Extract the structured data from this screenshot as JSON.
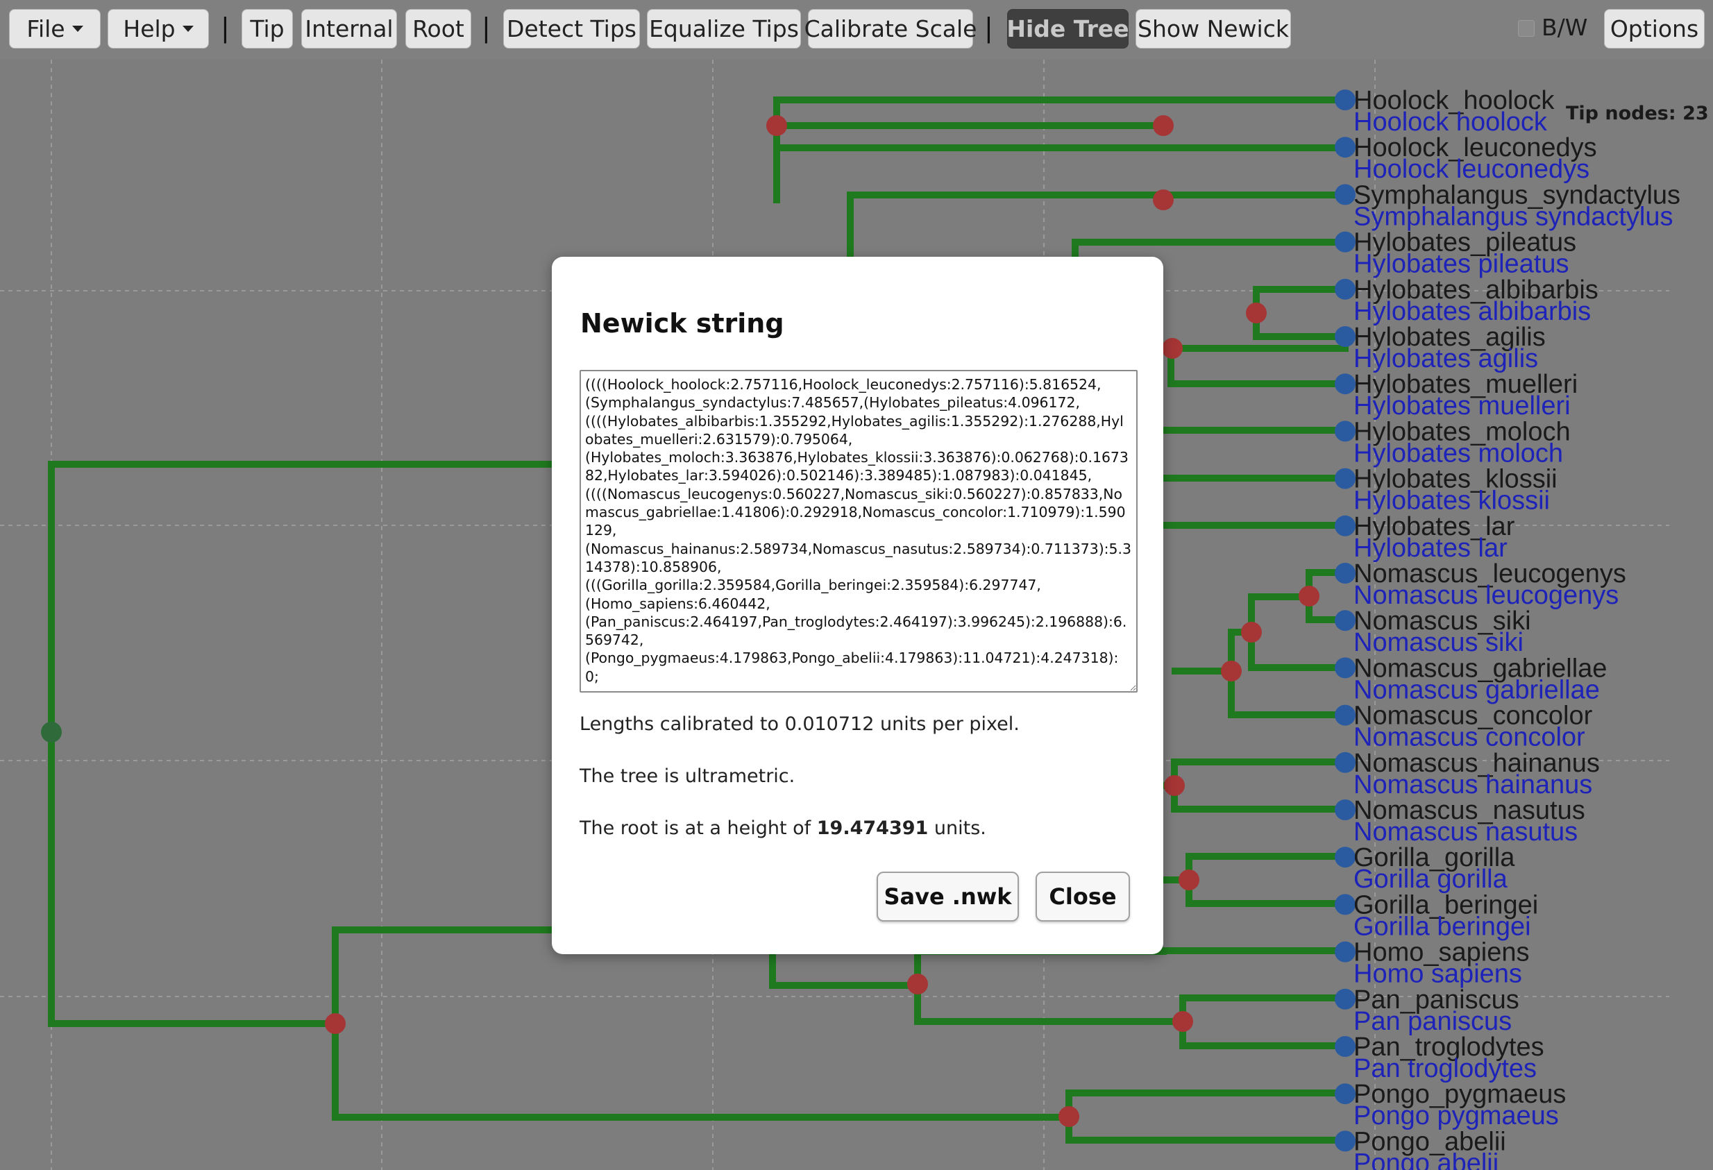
{
  "toolbar": {
    "file": "File",
    "help": "Help",
    "sep": "|",
    "tip": "Tip",
    "internal": "Internal",
    "root": "Root",
    "detect_tips": "Detect Tips",
    "equalize_tips": "Equalize Tips",
    "calibrate_scale": "Calibrate Scale",
    "hide_tree": "Hide Tree",
    "show_newick": "Show Newick",
    "bw_label": "B/W",
    "options": "Options"
  },
  "tip_count": "Tip nodes: 23",
  "tips": [
    "Hoolock_hoolock",
    "Hoolock_leuconedys",
    "Symphalangus_syndactylus",
    "Hylobates_pileatus",
    "Hylobates_albibarbis",
    "Hylobates_agilis",
    "Hylobates_muelleri",
    "Hylobates_moloch",
    "Hylobates_klossii",
    "Hylobates_lar",
    "Nomascus_leucogenys",
    "Nomascus_siki",
    "Nomascus_gabriellae",
    "Nomascus_concolor",
    "Nomascus_hainanus",
    "Nomascus_nasutus",
    "Gorilla_gorilla",
    "Gorilla_beringei",
    "Homo_sapiens",
    "Pan_paniscus",
    "Pan_troglodytes",
    "Pongo_pygmaeus",
    "Pongo_abelii"
  ],
  "tip_labels": [
    "Hoolock hoolock",
    "Hoolock leuconedys",
    "Symphalangus syndactylus",
    "Hylobates pileatus",
    "Hylobates albibarbis",
    "Hylobates agilis",
    "Hylobates muelleri",
    "Hylobates moloch",
    "Hylobates klossii",
    "Hylobates lar",
    "Nomascus leucogenys",
    "Nomascus siki",
    "Nomascus gabriellae",
    "Nomascus concolor",
    "Nomascus hainanus",
    "Nomascus nasutus",
    "Gorilla gorilla",
    "Gorilla beringei",
    "Homo sapiens",
    "Pan paniscus",
    "Pan troglodytes",
    "Pongo pygmaeus",
    "Pongo abelii"
  ],
  "colors": {
    "branch": "#1f7a1f",
    "internal_node": "#a63535",
    "root_node": "#2f6b3a",
    "tip_node": "#2a5aa0",
    "label_blue": "#1d22b8",
    "label_dark": "#1a1a1a",
    "background": "#7d7d7d",
    "grid": "#9a9a9a"
  },
  "modal": {
    "title": "Newick string",
    "newick": "((((Hoolock_hoolock:2.757116,Hoolock_leuconedys:2.757116):5.816524,\n(Symphalangus_syndactylus:7.485657,(Hylobates_pileatus:4.096172,\n((((Hylobates_albibarbis:1.355292,Hylobates_agilis:1.355292):1.276288,Hylobates_muelleri:2.631579):0.795064,\n(Hylobates_moloch:3.363876,Hylobates_klossii:3.363876):0.062768):0.167382,Hylobates_lar:3.594026):0.502146):3.389485):1.087983):0.041845,\n((((Nomascus_leucogenys:0.560227,Nomascus_siki:0.560227):0.857833,Nomascus_gabriellae:1.41806):0.292918,Nomascus_concolor:1.710979):1.590129,\n(Nomascus_hainanus:2.589734,Nomascus_nasutus:2.589734):0.711373):5.314378):10.858906,\n(((Gorilla_gorilla:2.359584,Gorilla_beringei:2.359584):6.297747,\n(Homo_sapiens:6.460442,\n(Pan_paniscus:2.464197,Pan_troglodytes:2.464197):3.996245):2.196888):6.569742,\n(Pongo_pygmaeus:4.179863,Pongo_abelii:4.179863):11.04721):4.247318):0;",
    "calibration": "Lengths calibrated to 0.010712 units per pixel.",
    "ultrametric": "The tree is ultrametric.",
    "root_height_prefix": "The root is at a height of ",
    "root_height_value": "19.474391",
    "root_height_suffix": " units.",
    "save_button": "Save .nwk",
    "close_button": "Close"
  }
}
